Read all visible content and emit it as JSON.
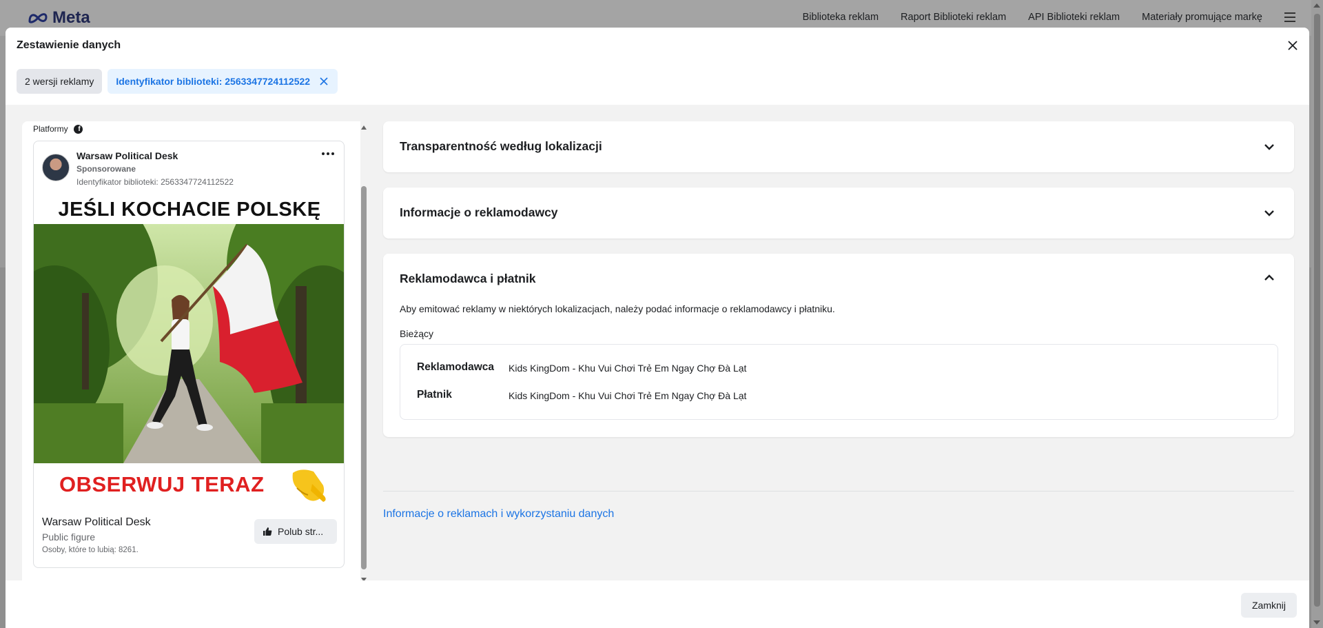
{
  "header": {
    "brand": "Meta",
    "nav": [
      "Biblioteka reklam",
      "Raport Biblioteki reklam",
      "API Biblioteki reklam",
      "Materiały promujące markę"
    ]
  },
  "modal": {
    "title": "Zestawienie danych",
    "chips": {
      "versions": "2 wersji reklamy",
      "library_id": "Identyfikator biblioteki: 2563347724112522"
    },
    "close_button": "Zamknij"
  },
  "ad": {
    "platforms_label": "Platformy",
    "advertiser": "Warsaw Political Desk",
    "sponsored": "Sponsorowane",
    "library_id": "Identyfikator biblioteki: 2563347724112522",
    "headline": "JEŚLI KOCHACIE POLSKĘ",
    "cta_text": "OBSERWUJ TERAZ",
    "page_name": "Warsaw Political Desk",
    "page_category": "Public figure",
    "likes": "Osoby, które to lubią: 8261.",
    "like_button": "Polub str..."
  },
  "sections": {
    "transparency": "Transparentność według lokalizacji",
    "advertiser_info": "Informacje o reklamodawcy",
    "payer": {
      "title": "Reklamodawca i płatnik",
      "description": "Aby emitować reklamy w niektórych lokalizacjach, należy podać informacje o reklamodawcy i płatniku.",
      "current_label": "Bieżący",
      "rows": [
        {
          "label": "Reklamodawca",
          "value": "Kids KingDom - Khu Vui Chơi Trẻ Em Ngay Chợ Đà Lạt"
        },
        {
          "label": "Płatnik",
          "value": "Kids KingDom - Khu Vui Chơi Trẻ Em Ngay Chợ Đà Lạt"
        }
      ]
    }
  },
  "footer_link": "Informacje o reklamach i wykorzystaniu danych",
  "colors": {
    "link": "#1b74e4",
    "chip_blue_bg": "#e7f3ff",
    "cta_red": "#e02020"
  }
}
